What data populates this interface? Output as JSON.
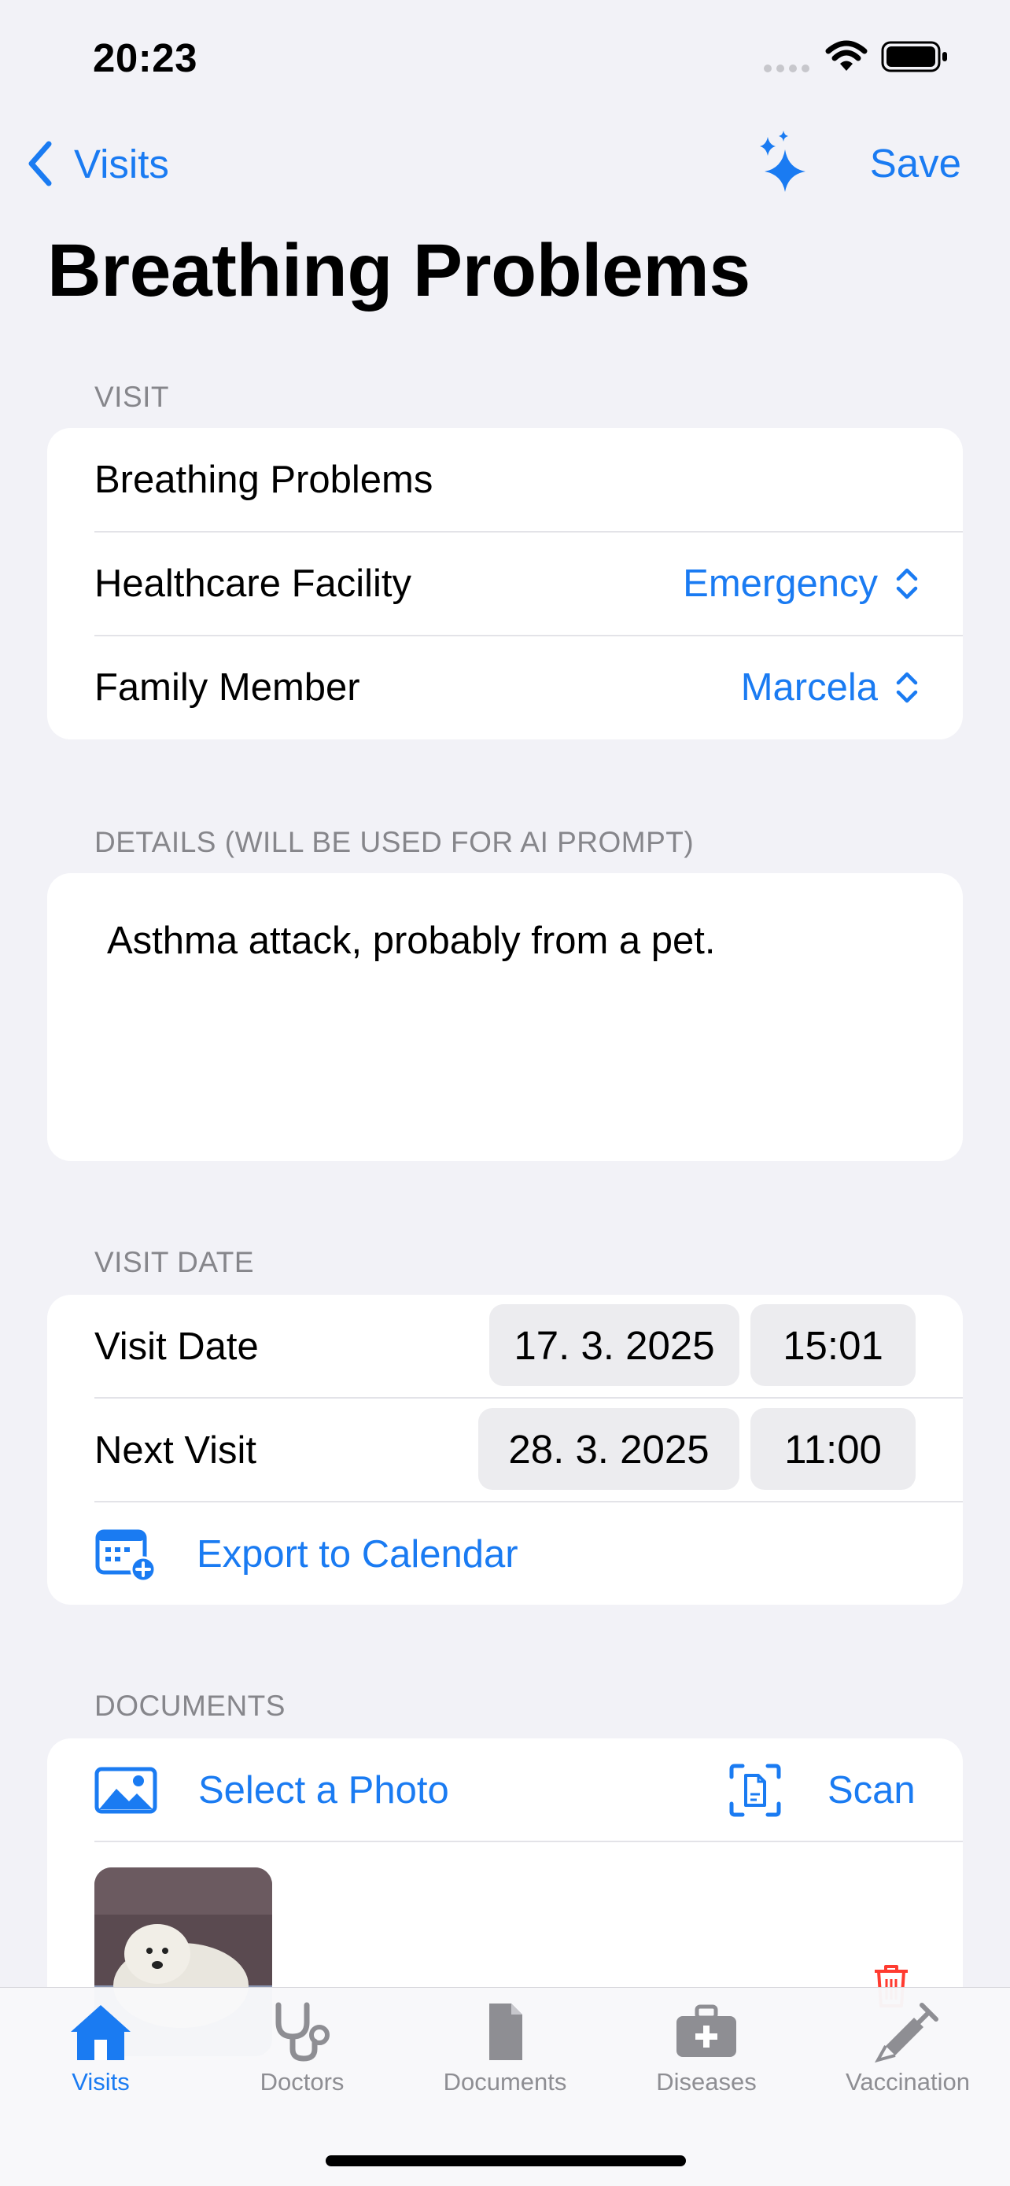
{
  "status_bar": {
    "time": "20:23"
  },
  "nav": {
    "back_label": "Visits",
    "save_label": "Save"
  },
  "page_title": "Breathing Problems",
  "visit_section": {
    "header": "VISIT",
    "name_value": "Breathing Problems",
    "facility_label": "Healthcare Facility",
    "facility_value": "Emergency",
    "member_label": "Family Member",
    "member_value": "Marcela"
  },
  "details_section": {
    "header": "DETAILS (WILL BE USED FOR AI PROMPT)",
    "text": "Asthma attack, probably from a pet."
  },
  "date_section": {
    "header": "VISIT DATE",
    "visit_label": "Visit Date",
    "visit_date": "17. 3. 2025",
    "visit_time": "15:01",
    "next_label": "Next Visit",
    "next_date": "28. 3. 2025",
    "next_time": "11:00",
    "export_label": "Export to Calendar"
  },
  "documents_section": {
    "header": "DOCUMENTS",
    "select_photo_label": "Select a Photo",
    "scan_label": "Scan"
  },
  "tab_bar": {
    "tabs": [
      {
        "label": "Visits",
        "icon": "house-icon",
        "active": true
      },
      {
        "label": "Doctors",
        "icon": "stethoscope-icon"
      },
      {
        "label": "Documents",
        "icon": "document-icon"
      },
      {
        "label": "Diseases",
        "icon": "medkit-icon"
      },
      {
        "label": "Vaccination",
        "icon": "syringe-icon"
      }
    ]
  },
  "colors": {
    "accent": "#1a7bf2",
    "background": "#f2f2f7",
    "destructive": "#ff3b30"
  }
}
